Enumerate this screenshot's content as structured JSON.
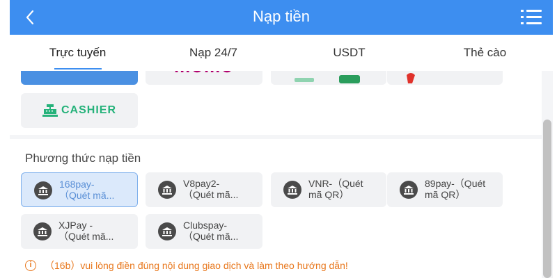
{
  "header": {
    "title": "Nạp tiền"
  },
  "tabs": [
    {
      "label": "Trực tuyến",
      "active": true
    },
    {
      "label": "Nạp 24/7",
      "active": false
    },
    {
      "label": "USDT",
      "active": false
    },
    {
      "label": "Thẻ cào",
      "active": false
    }
  ],
  "top_options": {
    "cashier_label": "CASHIER",
    "partial_logo": "momo",
    "colors": {
      "momo": "#b0006d",
      "zalo": "#2a9d5c",
      "red": "#e0322b",
      "cashier": "#25b27a"
    }
  },
  "methods": {
    "title": "Phương thức nạp tiền",
    "items": [
      {
        "label": "168pay-\n（Quét mã...",
        "selected": true
      },
      {
        "label": "V8pay2-\n（Quét mã...",
        "selected": false
      },
      {
        "label": "VNR-（Quét\nmã QR）",
        "selected": false
      },
      {
        "label": "89pay-（Quét\nmã QR）",
        "selected": false
      },
      {
        "label": "XJPay -\n（Quét mã...",
        "selected": false
      },
      {
        "label": "Clubspay-\n（Quét mã...",
        "selected": false
      }
    ]
  },
  "notice": {
    "icon": "i",
    "text": "（16b）vui lòng điền đúng nội dung giao dịch và làm theo hướng dẫn!"
  },
  "colors": {
    "accent": "#3d8ef0",
    "notice": "#e8781e"
  }
}
